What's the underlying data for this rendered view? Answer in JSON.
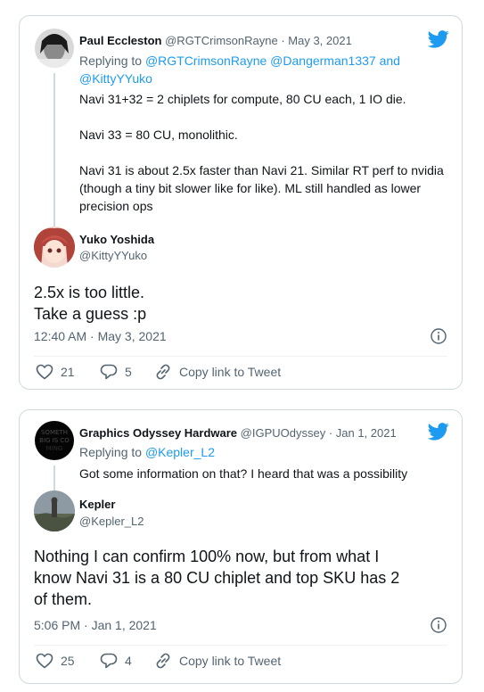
{
  "tweet1": {
    "parent": {
      "name": "Paul Eccleston",
      "handle_date": "@RGTCrimsonRayne · May 3, 2021",
      "replying_to_prefix": "Replying to ",
      "replying_to_line1": "@RGTCrimsonRayne @Dangerman1337 and",
      "replying_to_line2": "@KittyYYuko",
      "paragraphs": [
        "Navi 31+32 = 2 chiplets for compute, 80 CU each, 1 IO die.",
        "Navi 33 = 80 CU, monolithic.",
        "Navi 31 is about 2.5x faster than Navi 21. Similar RT perf to nvidia (though a tiny bit slower like for like). ML still handled as lower precision ops"
      ]
    },
    "main": {
      "name": "Yuko Yoshida",
      "handle": "@KittyYYuko",
      "lines": [
        "2.5x is too little.",
        "Take a guess :p"
      ],
      "timestamp": "12:40 AM · May 3, 2021"
    },
    "actions": {
      "likes": "21",
      "replies": "5",
      "copy_link": "Copy link to Tweet"
    }
  },
  "tweet2": {
    "parent": {
      "name": "Graphics Odyssey Hardware",
      "handle_date": "@IGPUOdyssey · Jan 1, 2021",
      "replying_to_prefix": "Replying to ",
      "replying_to_user": "@Kepler_L2",
      "text": "Got some information on that? I heard that was a possibility",
      "avatar_text": "SOMETHING BIG IS COMING"
    },
    "main": {
      "name": "Kepler",
      "handle": "@Kepler_L2",
      "lines": [
        "Nothing I can confirm 100% now, but from what I",
        "know Navi 31 is a 80 CU chiplet and top SKU has 2",
        "of them."
      ],
      "timestamp": "5:06 PM · Jan 1, 2021"
    },
    "actions": {
      "likes": "25",
      "replies": "4",
      "copy_link": "Copy link to Tweet"
    }
  },
  "icons": {
    "brand": "twitter-bird-icon",
    "like": "heart-icon",
    "reply": "speech-bubble-icon",
    "copy": "link-icon",
    "info": "info-icon"
  },
  "colors": {
    "twitter_blue": "#1d9bf0",
    "secondary_text": "#536471",
    "border": "#cfd9de"
  }
}
